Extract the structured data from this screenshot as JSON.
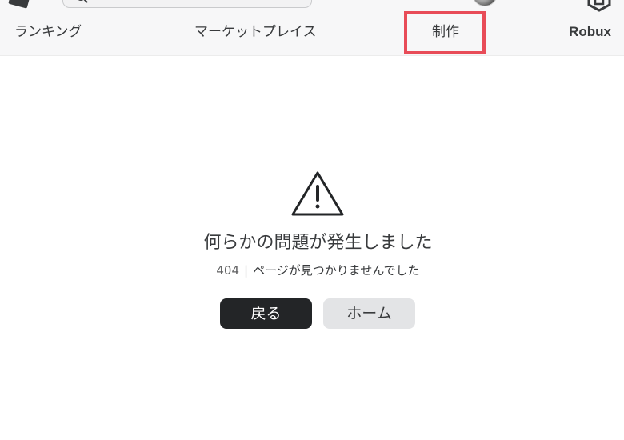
{
  "header": {
    "logo_icon": "roblox-logo-icon",
    "search": {
      "icon": "search-icon",
      "value": ""
    },
    "avatar_icon": "avatar-icon",
    "robux_icon": "robux-icon",
    "nav": {
      "ranking": "ランキング",
      "marketplace": "マーケットプレイス",
      "create": "制作",
      "robux": "Robux"
    },
    "highlight_color": "#e84c58"
  },
  "error": {
    "icon": "warning-icon",
    "title": "何らかの問題が発生しました",
    "code": "404",
    "separator": "|",
    "message": "ページが見つかりませんでした",
    "buttons": {
      "back": "戻る",
      "home": "ホーム"
    }
  },
  "colors": {
    "primary_button": "#232527",
    "secondary_button": "#e3e4e6",
    "text": "#393b3d"
  }
}
